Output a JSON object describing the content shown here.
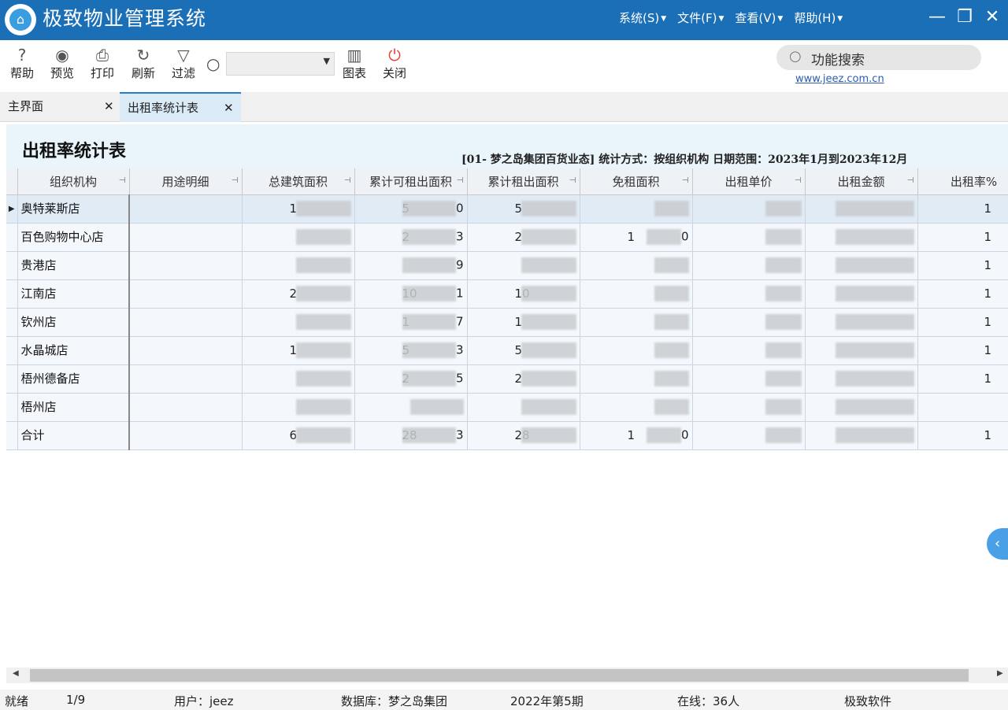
{
  "app": {
    "title": "极致物业管理系统",
    "logo_glyph": "⌂"
  },
  "menu": [
    {
      "label": "系统(S)"
    },
    {
      "label": "文件(F)"
    },
    {
      "label": "查看(V)"
    },
    {
      "label": "帮助(H)"
    }
  ],
  "window_controls": {
    "minimize": "—",
    "restore": "❐",
    "close": "✕"
  },
  "toolbar": {
    "help": {
      "label": "帮助",
      "icon": "?"
    },
    "preview": {
      "label": "预览",
      "icon": "◉"
    },
    "print": {
      "label": "打印",
      "icon": "⎙"
    },
    "refresh": {
      "label": "刷新",
      "icon": "↻"
    },
    "filter": {
      "label": "过滤",
      "icon": "▽"
    },
    "chart": {
      "label": "图表",
      "icon": "▥"
    },
    "close": {
      "label": "关闭",
      "icon": "⏻"
    },
    "combo_arrow": "▼",
    "search_glyph": "○"
  },
  "func_search": {
    "placeholder": "功能搜索"
  },
  "website": "www.jeez.com.cn",
  "tabs": [
    {
      "label": "主界面",
      "close": "✕"
    },
    {
      "label": "出租率统计表",
      "close": "✕"
    }
  ],
  "report": {
    "title": "出租率统计表",
    "info": "[01- 梦之岛集团百货业态] 统计方式：按组织机构 日期范围：2023年1月到2023年12月"
  },
  "table": {
    "columns": [
      "组织机构",
      "用途明细",
      "总建筑面积",
      "累计可租出面积",
      "累计租出面积",
      "免租面积",
      "出租单价",
      "出租金额",
      "出租率%"
    ],
    "pin_glyph": "⊣",
    "row_marker": "▶",
    "rows": [
      {
        "name": "奥特莱斯店",
        "vis": [
          "1",
          "5",
          "5",
          "",
          "",
          "",
          "1"
        ],
        "tail": [
          "",
          "0",
          "",
          "",
          "",
          "",
          ""
        ]
      },
      {
        "name": "百色购物中心店",
        "vis": [
          "",
          "2",
          "2",
          "1",
          "",
          "",
          "1"
        ],
        "tail": [
          "",
          "3",
          "",
          "0",
          "",
          "",
          ""
        ]
      },
      {
        "name": "贵港店",
        "vis": [
          "",
          "",
          "",
          "",
          "",
          "",
          "1"
        ],
        "tail": [
          "",
          "9",
          "",
          "",
          "",
          "",
          ""
        ]
      },
      {
        "name": "江南店",
        "vis": [
          "2",
          "10",
          "10",
          "",
          "",
          "",
          "1"
        ],
        "tail": [
          "",
          "1",
          "",
          "",
          "",
          "",
          ""
        ]
      },
      {
        "name": "钦州店",
        "vis": [
          "",
          "1",
          "1",
          "",
          "",
          "",
          "1"
        ],
        "tail": [
          "",
          "7",
          "",
          "",
          "",
          "",
          ""
        ]
      },
      {
        "name": "水晶城店",
        "vis": [
          "1",
          "5",
          "5",
          "",
          "",
          "",
          "1"
        ],
        "tail": [
          "",
          "3",
          "",
          "",
          "",
          "",
          ""
        ]
      },
      {
        "name": "梧州德备店",
        "vis": [
          "",
          "2",
          "2",
          "",
          "",
          "",
          "1"
        ],
        "tail": [
          "",
          "5",
          "",
          "",
          "",
          "",
          ""
        ]
      },
      {
        "name": "梧州店",
        "vis": [
          "",
          "",
          "",
          "",
          "",
          "",
          ""
        ],
        "tail": [
          "",
          "",
          "",
          "",
          "",
          "",
          ""
        ]
      },
      {
        "name": "合计",
        "vis": [
          "6",
          "28",
          "28",
          "1",
          "",
          "",
          "1"
        ],
        "tail": [
          "",
          "3",
          "",
          "0",
          "",
          "",
          ""
        ]
      }
    ]
  },
  "scroll": {
    "left": "◀",
    "right": "▶"
  },
  "side_handle": "‹",
  "status": {
    "ready": "就绪",
    "page": "1/9",
    "user": "用户：jeez",
    "db": "数据库：梦之岛集团",
    "period": "2022年第5期",
    "online": "在线：36人",
    "company": "极致软件"
  }
}
